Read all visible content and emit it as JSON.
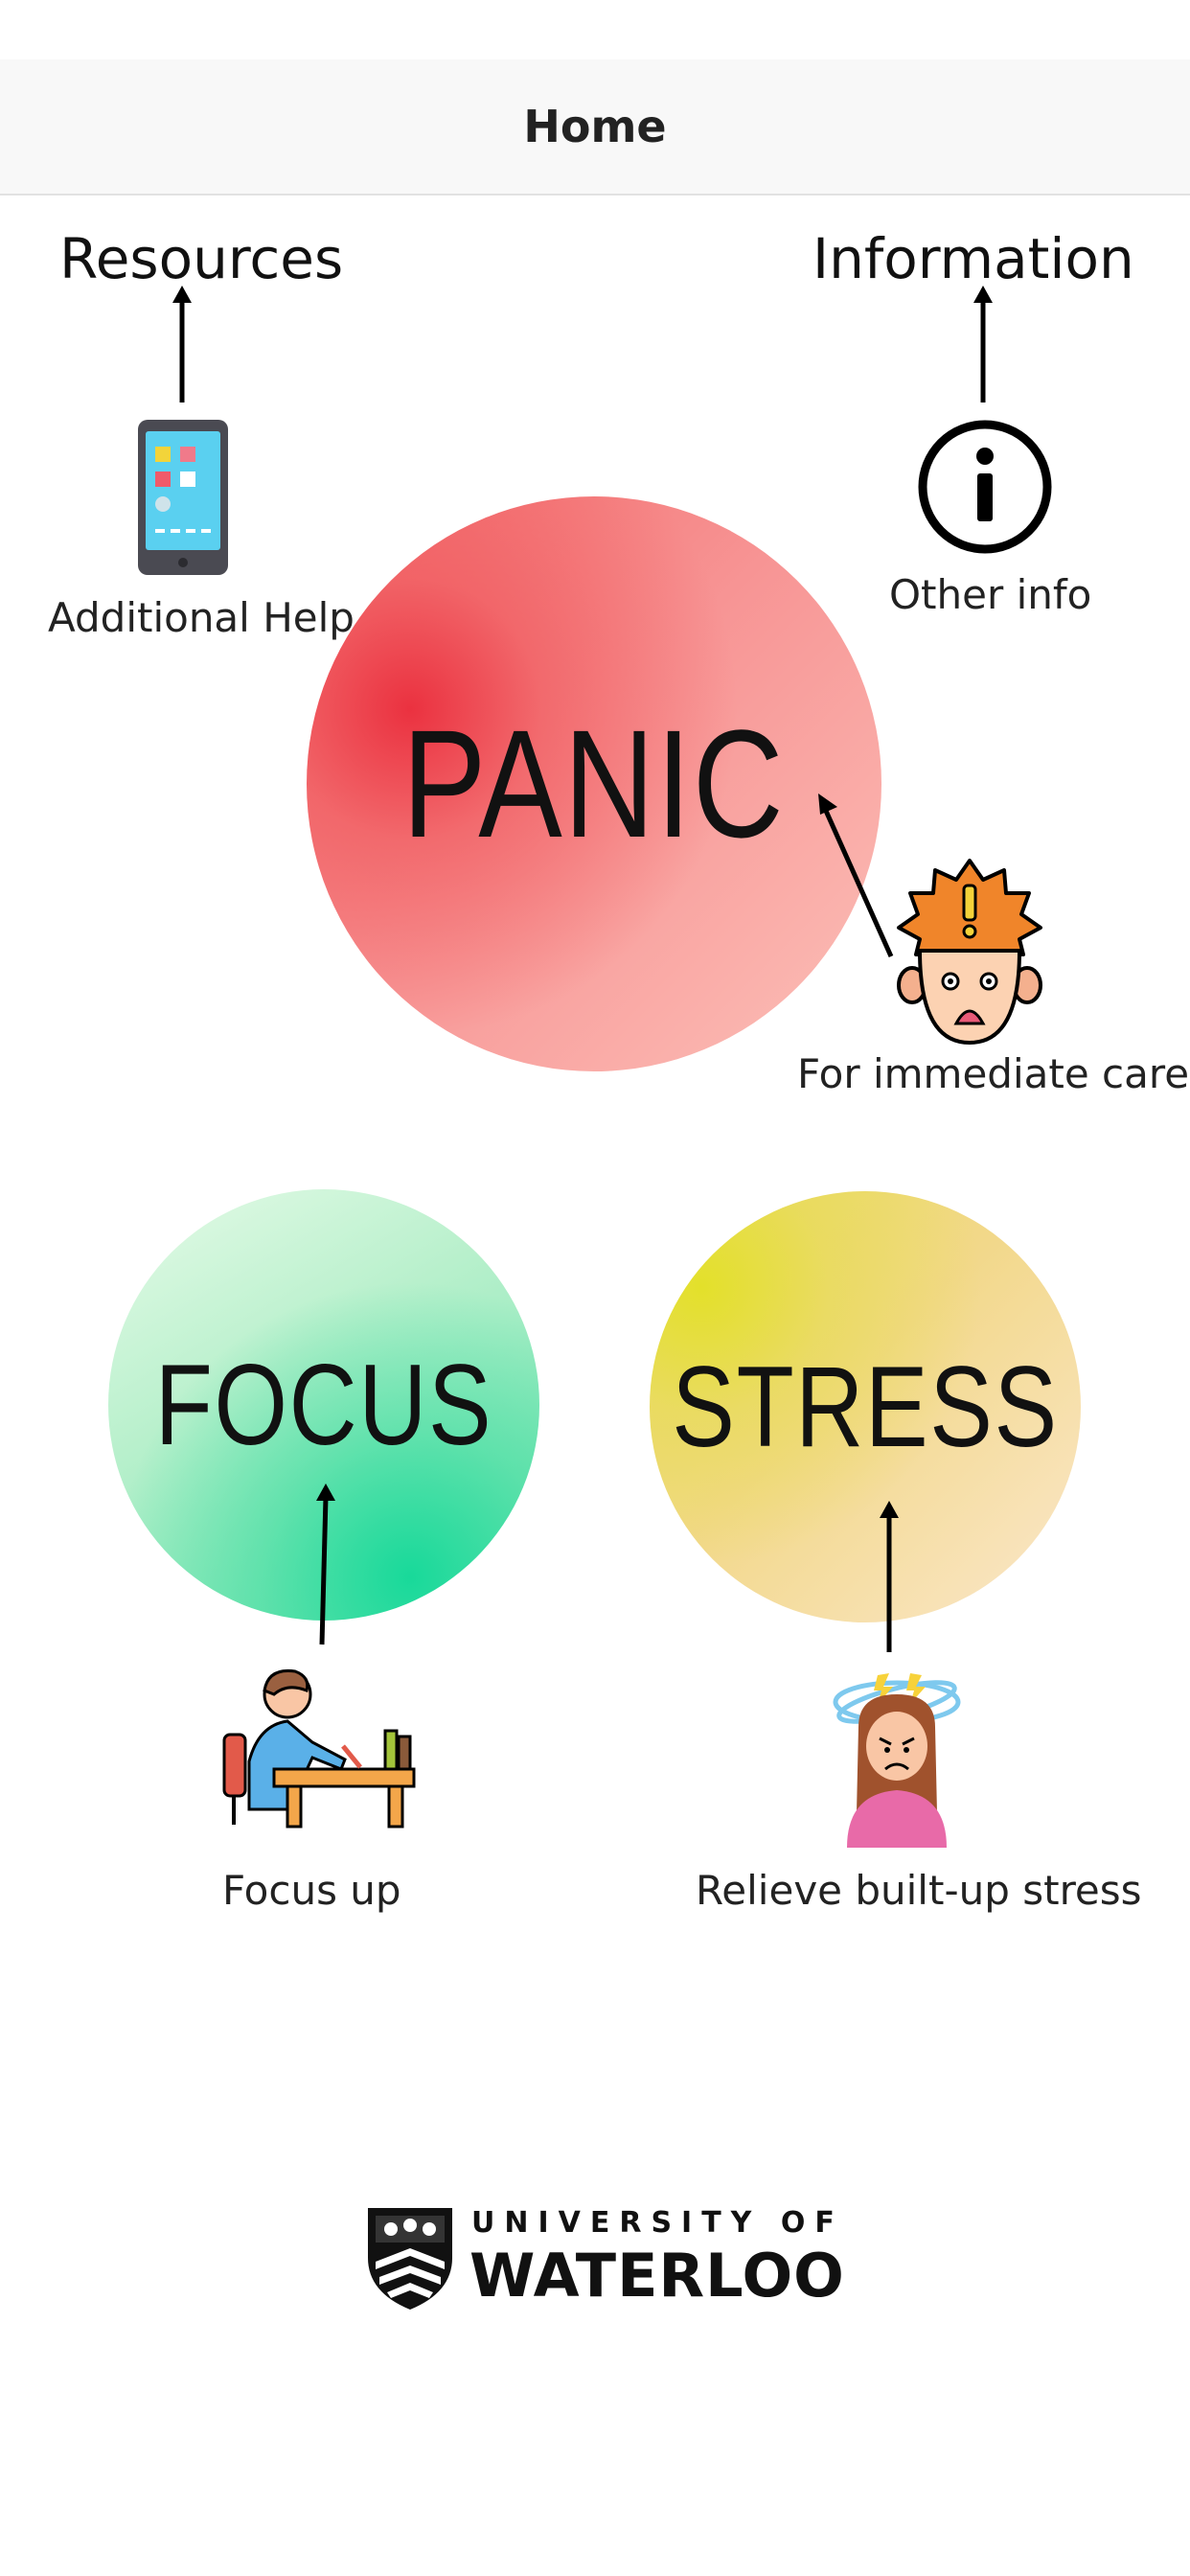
{
  "nav": {
    "title": "Home"
  },
  "links": {
    "resources": {
      "heading": "Resources",
      "caption": "Additional Help",
      "icon": "smartphone-icon"
    },
    "information": {
      "heading": "Information",
      "caption": "Other info",
      "icon": "info-icon"
    }
  },
  "panic": {
    "label": "PANIC",
    "caption": "For immediate care",
    "icon": "panicked-face-icon",
    "color": "#f36b6b"
  },
  "focus": {
    "label": "FOCUS",
    "caption": "Focus up",
    "icon": "studying-person-icon",
    "color": "#18d99a"
  },
  "stress": {
    "label": "STRESS",
    "caption": "Relieve built-up stress",
    "icon": "stressed-woman-icon",
    "color": "#eadc60"
  },
  "footer": {
    "logo_line1": "UNIVERSITY OF",
    "logo_line2": "WATERLOO"
  }
}
